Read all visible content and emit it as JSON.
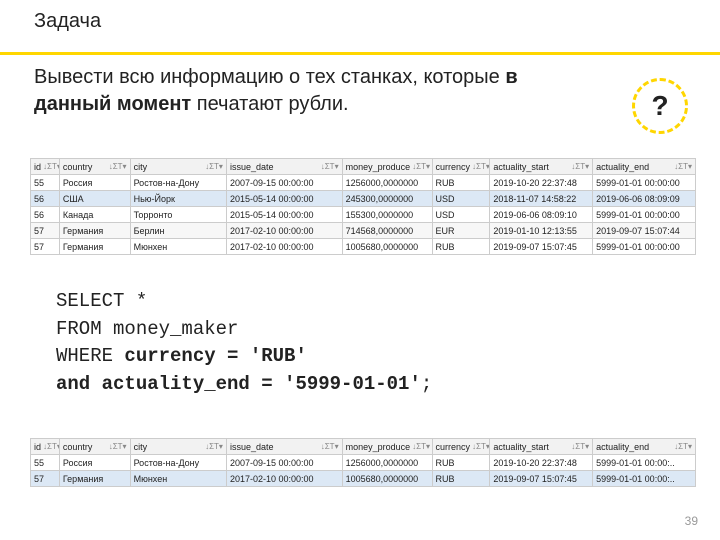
{
  "title": "Задача",
  "desc_1": "Вывести всю информацию о тех станках, которые ",
  "desc_bold": "в данный момент",
  "desc_2": " печатают рубли.",
  "question_mark": "?",
  "hdr_glyphs": "↓ΣT▾",
  "columns": [
    "id",
    "country",
    "city",
    "issue_date",
    "money_produce",
    "currency",
    "actuality_start",
    "actuality_end"
  ],
  "table1_rows": [
    {
      "sel": false,
      "cells": [
        "55",
        "Россия",
        "Ростов-на-Дону",
        "2007-09-15 00:00:00",
        "1256000,0000000",
        "RUB",
        "2019-10-20 22:37:48",
        "5999-01-01 00:00:00"
      ]
    },
    {
      "sel": true,
      "cells": [
        "56",
        "США",
        "Нью-Йорк",
        "2015-05-14 00:00:00",
        "245300,0000000",
        "USD",
        "2018-11-07 14:58:22",
        "2019-06-06 08:09:09"
      ]
    },
    {
      "sel": false,
      "cells": [
        "56",
        "Канада",
        "Торронто",
        "2015-05-14 00:00:00",
        "155300,0000000",
        "USD",
        "2019-06-06 08:09:10",
        "5999-01-01 00:00:00"
      ]
    },
    {
      "sel": false,
      "cells": [
        "57",
        "Германия",
        "Берлин",
        "2017-02-10 00:00:00",
        "714568,0000000",
        "EUR",
        "2019-01-10 12:13:55",
        "2019-09-07 15:07:44"
      ]
    },
    {
      "sel": false,
      "cells": [
        "57",
        "Германия",
        "Мюнхен",
        "2017-02-10 00:00:00",
        "1005680,0000000",
        "RUB",
        "2019-09-07 15:07:45",
        "5999-01-01 00:00:00"
      ]
    }
  ],
  "table2_rows": [
    {
      "sel": false,
      "cells": [
        "55",
        "Россия",
        "Ростов-на-Дону",
        "2007-09-15 00:00:00",
        "1256000,0000000",
        "RUB",
        "2019-10-20 22:37:48",
        "5999-01-01 00:00:.."
      ]
    },
    {
      "sel": true,
      "cells": [
        "57",
        "Германия",
        "Мюнхен",
        "2017-02-10 00:00:00",
        "1005680,0000000",
        "RUB",
        "2019-09-07 15:07:45",
        "5999-01-01 00:00:.."
      ]
    }
  ],
  "sql": {
    "l1": "SELECT *",
    "l2": "FROM money_maker",
    "l3a": "WHERE ",
    "l3b": "currency = 'RUB'",
    "l4a": "and actuality_end = '5999-01-01'",
    "l4b": ";"
  },
  "page": "39",
  "chart_data": {
    "type": "table",
    "columns": [
      "id",
      "country",
      "city",
      "issue_date",
      "money_produce",
      "currency",
      "actuality_start",
      "actuality_end"
    ],
    "source_rows": [
      [
        55,
        "Россия",
        "Ростов-на-Дону",
        "2007-09-15 00:00:00",
        1256000.0,
        "RUB",
        "2019-10-20 22:37:48",
        "5999-01-01 00:00:00"
      ],
      [
        56,
        "США",
        "Нью-Йорк",
        "2015-05-14 00:00:00",
        245300.0,
        "USD",
        "2018-11-07 14:58:22",
        "2019-06-06 08:09:09"
      ],
      [
        56,
        "Канада",
        "Торронто",
        "2015-05-14 00:00:00",
        155300.0,
        "USD",
        "2019-06-06 08:09:10",
        "5999-01-01 00:00:00"
      ],
      [
        57,
        "Германия",
        "Берлин",
        "2017-02-10 00:00:00",
        714568.0,
        "EUR",
        "2019-01-10 12:13:55",
        "2019-09-07 15:07:44"
      ],
      [
        57,
        "Германия",
        "Мюнхен",
        "2017-02-10 00:00:00",
        1005680.0,
        "RUB",
        "2019-09-07 15:07:45",
        "5999-01-01 00:00:00"
      ]
    ],
    "result_rows": [
      [
        55,
        "Россия",
        "Ростов-на-Дону",
        "2007-09-15 00:00:00",
        1256000.0,
        "RUB",
        "2019-10-20 22:37:48",
        "5999-01-01 00:00:00"
      ],
      [
        57,
        "Германия",
        "Мюнхен",
        "2017-02-10 00:00:00",
        1005680.0,
        "RUB",
        "2019-09-07 15:07:45",
        "5999-01-01 00:00:00"
      ]
    ]
  }
}
